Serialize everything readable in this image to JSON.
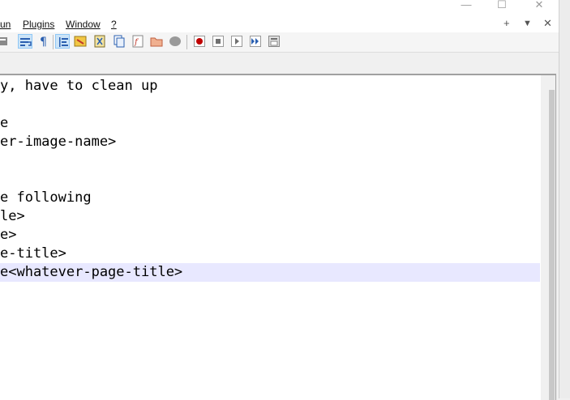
{
  "menubar": {
    "items": [
      {
        "label": "un"
      },
      {
        "label": "Plugins"
      },
      {
        "label": "Window"
      },
      {
        "label": "?"
      }
    ],
    "tab_add": "+",
    "tab_list": "▼",
    "tab_close": "✕"
  },
  "window_controls": {
    "minimize": "—",
    "maximize": "☐",
    "close": "✕"
  },
  "toolbar": {
    "icons": [
      "partial-icon",
      "word-wrap-icon",
      "show-all-characters-icon",
      "indent-guide-icon",
      "define-language-icon",
      "document-map-icon",
      "document-list-icon",
      "function-list-icon",
      "folder-as-workspace-icon",
      "monitoring-icon",
      "record-macro-icon",
      "stop-recording-icon",
      "playback-macro-icon",
      "run-macro-multiple-icon",
      "save-macro-icon"
    ]
  },
  "editor": {
    "lines": [
      {
        "text": "y, have to clean up"
      },
      {
        "text": ""
      },
      {
        "text": "e"
      },
      {
        "text": "er-image-name>"
      },
      {
        "text": ""
      },
      {
        "text": ""
      },
      {
        "text": "e following"
      },
      {
        "text": "le>"
      },
      {
        "text": "e>"
      },
      {
        "text": "e-title>"
      },
      {
        "text": "e<whatever-page-title>"
      }
    ],
    "current_line_index": 10,
    "colors": {
      "current_line": "#e8e8ff",
      "text": "#000000"
    }
  }
}
